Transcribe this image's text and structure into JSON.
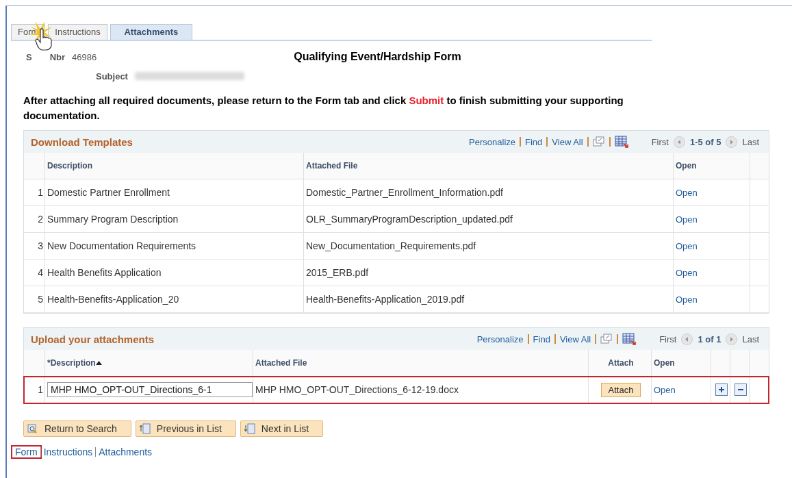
{
  "tabs": [
    {
      "label": "Form",
      "selected": false
    },
    {
      "label": "Instructions",
      "selected": false
    },
    {
      "label": "Attachments",
      "selected": true
    }
  ],
  "header": {
    "id_label_start": "S",
    "id_label_end": "Nbr",
    "id_value": "46986",
    "title": "Qualifying Event/Hardship Form",
    "subject_label": "Subject"
  },
  "instruction": "After attaching all required documents, please return to the Form tab and click **Submit** to finish submitting your supporting documentation.",
  "templates": {
    "title": "Download Templates",
    "links": [
      "Personalize",
      "Find",
      "View All"
    ],
    "first": "First",
    "range": "1-5 of 5",
    "last": "Last",
    "columns": [
      "Description",
      "Attached File",
      "Open"
    ],
    "rows": [
      {
        "num": "1",
        "description": "Domestic Partner Enrollment",
        "file": "Domestic_Partner_Enrollment_Information.pdf",
        "open": "Open"
      },
      {
        "num": "2",
        "description": "Summary Program Description",
        "file": "OLR_SummaryProgramDescription_updated.pdf",
        "open": "Open"
      },
      {
        "num": "3",
        "description": "New Documentation Requirements",
        "file": "New_Documentation_Requirements.pdf",
        "open": "Open"
      },
      {
        "num": "4",
        "description": "Health Benefits Application",
        "file": "2015_ERB.pdf",
        "open": "Open"
      },
      {
        "num": "5",
        "description": "Health-Benefits-Application_20",
        "file": "Health-Benefits-Application_2019.pdf",
        "open": "Open"
      }
    ]
  },
  "uploads": {
    "title": "Upload your attachments",
    "links": [
      "Personalize",
      "Find",
      "View All"
    ],
    "first": "First",
    "range": "1 of 1",
    "last": "Last",
    "columns": [
      "*Description",
      "Attached File",
      "Attach",
      "Open"
    ],
    "rows": [
      {
        "num": "1",
        "description": "MHP HMO_OPT-OUT_Directions_6-1",
        "file": "MHP HMO_OPT-OUT_Directions_6-12-19.docx",
        "attach": "Attach",
        "open": "Open",
        "highlighted": true
      }
    ]
  },
  "buttons": [
    "Return to Search",
    "Previous in List",
    "Next in List"
  ],
  "footer_links": [
    {
      "label": "Form",
      "highlighted": true
    },
    {
      "label": "Instructions",
      "highlighted": false
    },
    {
      "label": "Attachments",
      "highlighted": false
    }
  ]
}
